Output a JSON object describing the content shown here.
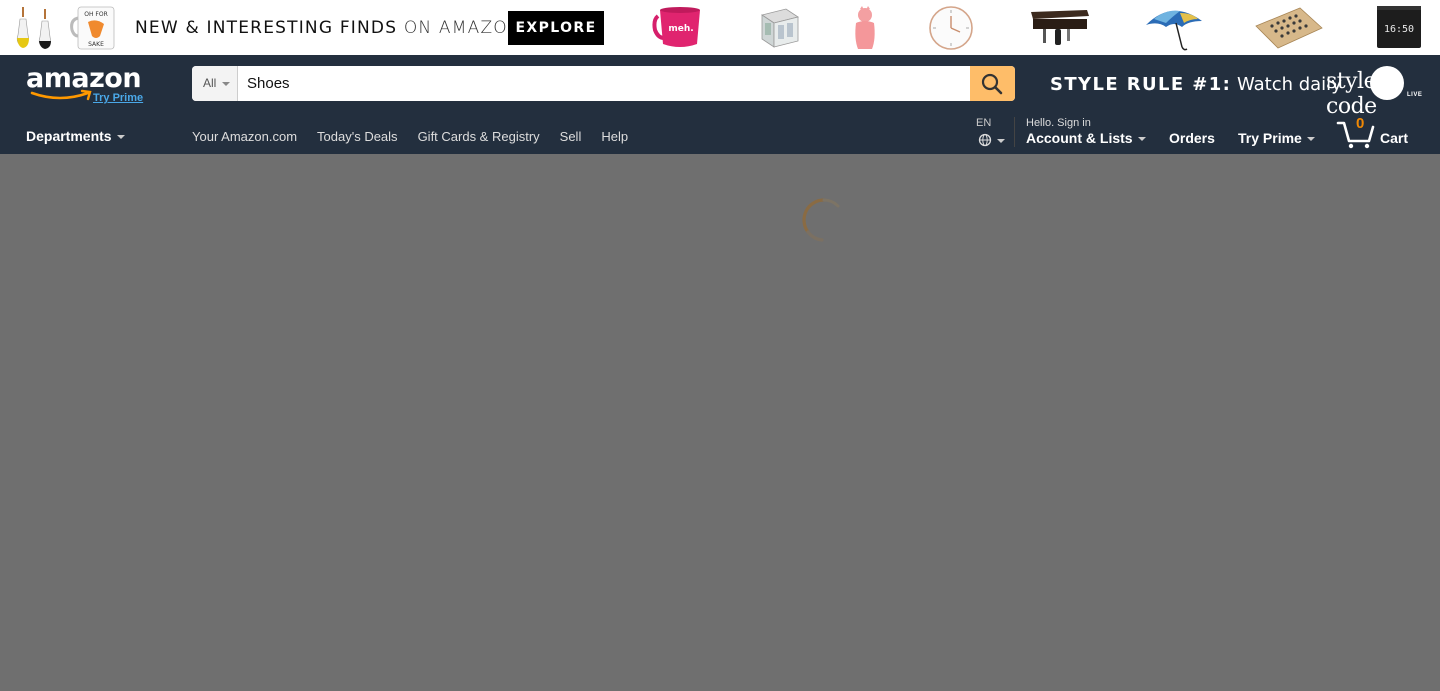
{
  "banner": {
    "headline_bold": "NEW & INTERESTING FINDS",
    "headline_light": "ON AMAZON",
    "explore_label": "EXPLORE",
    "mug_text": "meh.",
    "sake_text_line1": "OH FOR",
    "sake_text_line2": "SAKE",
    "clock_display": "16:50"
  },
  "nav": {
    "logo_text": "amazon",
    "logo_prime": "Try Prime",
    "search": {
      "scope_label": "All",
      "query": "Shoes"
    },
    "style_rule": {
      "bold": "STYLE RULE #1:",
      "text": "Watch daily",
      "brand": "style code",
      "brand_sub": "LIVE"
    },
    "departments_label": "Departments",
    "links": [
      "Your Amazon.com",
      "Today's Deals",
      "Gift Cards & Registry",
      "Sell",
      "Help"
    ],
    "language": "EN",
    "account_greeting": "Hello. Sign in",
    "account_label": "Account & Lists",
    "orders_label": "Orders",
    "try_prime_label": "Try Prime",
    "cart_count": "0",
    "cart_label": "Cart"
  },
  "colors": {
    "nav_bg": "#232f3e",
    "search_button": "#febd69",
    "cart_count": "#f08804",
    "overlay": "#6f6f6f",
    "link_blue": "#4aa8e8"
  }
}
